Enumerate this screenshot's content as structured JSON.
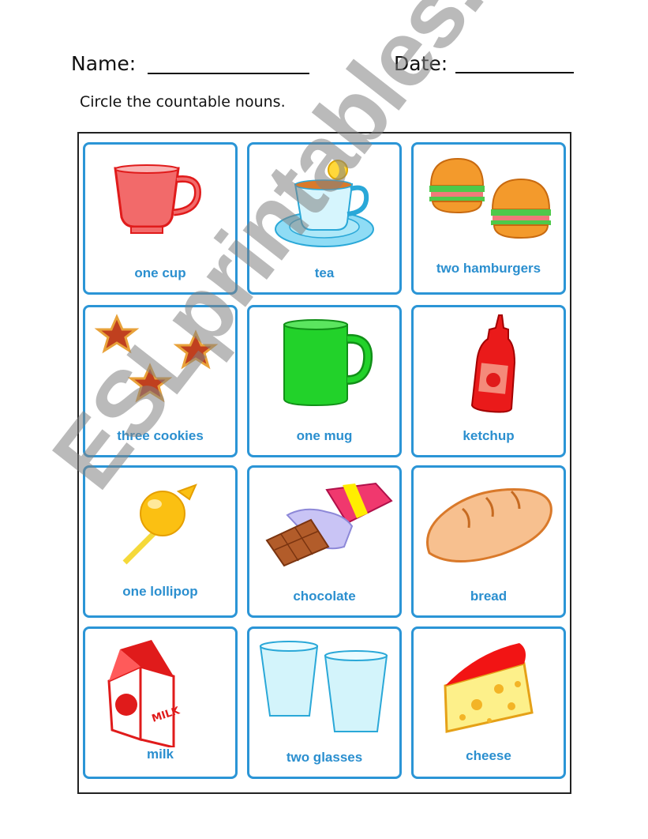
{
  "header": {
    "name_label": "Name:",
    "date_label": "Date:",
    "instruction": "Circle the countable nouns."
  },
  "cards": [
    {
      "label": "one cup",
      "icon": "red-cup-icon"
    },
    {
      "label": "tea",
      "icon": "tea-cup-icon"
    },
    {
      "label": "two hamburgers",
      "icon": "hamburgers-icon"
    },
    {
      "label": "three cookies",
      "icon": "cookies-icon"
    },
    {
      "label": "one mug",
      "icon": "green-mug-icon"
    },
    {
      "label": "ketchup",
      "icon": "ketchup-bottle-icon"
    },
    {
      "label": "one lollipop",
      "icon": "lollipop-icon"
    },
    {
      "label": "chocolate",
      "icon": "chocolate-bar-icon"
    },
    {
      "label": "bread",
      "icon": "bread-loaf-icon"
    },
    {
      "label": "milk",
      "icon": "milk-carton-icon"
    },
    {
      "label": "two glasses",
      "icon": "glasses-icon"
    },
    {
      "label": "cheese",
      "icon": "cheese-icon"
    }
  ],
  "colors": {
    "card_border": "#2b95d6",
    "label_text": "#2b8fcf"
  },
  "watermark": "ESLprintables.com"
}
